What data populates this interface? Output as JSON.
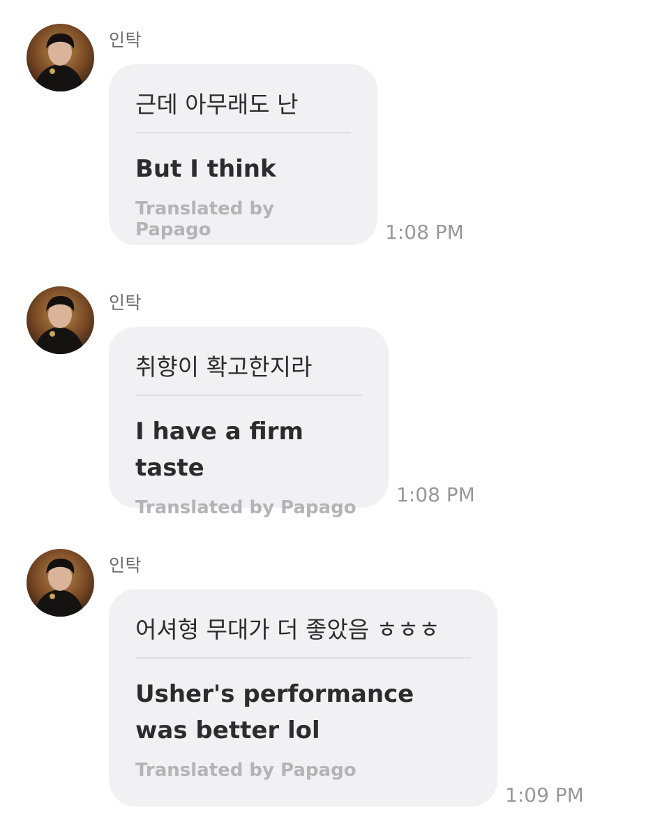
{
  "messages": [
    {
      "sender": "인탁",
      "original": "근데 아무래도 난",
      "translation": "But I think",
      "credit": "Translated by Papago",
      "time": "1:08 PM"
    },
    {
      "sender": "인탁",
      "original": "취향이 확고한지라",
      "translation": "I have a firm taste",
      "credit": "Translated by Papago",
      "time": "1:08 PM"
    },
    {
      "sender": "인탁",
      "original": "어셔형 무대가 더 좋았음 ㅎㅎㅎ",
      "translation": "Usher's performance was better lol",
      "credit": "Translated by Papago",
      "time": "1:09 PM"
    }
  ]
}
